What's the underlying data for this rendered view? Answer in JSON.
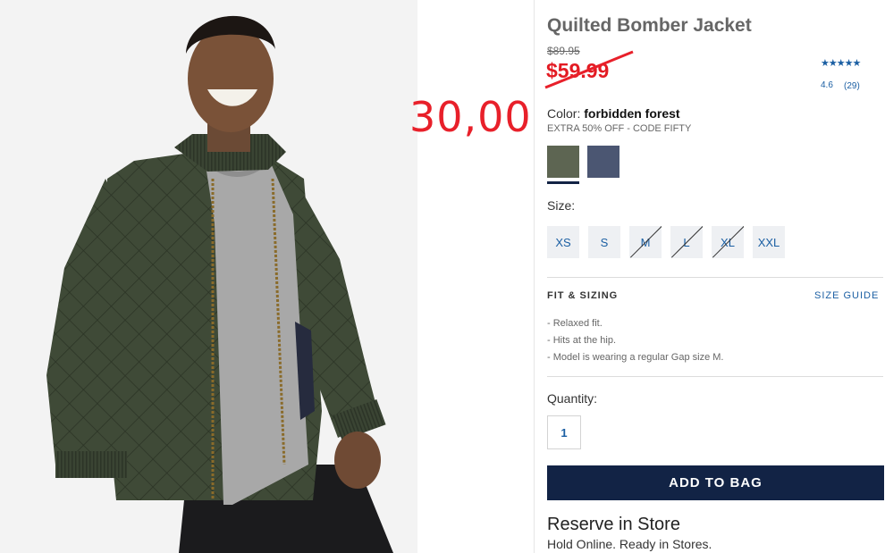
{
  "product": {
    "title": "Quilted Bomber Jacket",
    "original_price": "$89.95",
    "sale_price": "$59.99",
    "rating": {
      "stars": "★★★★★",
      "score": "4.6",
      "count": "(29)",
      "value": 4.6
    }
  },
  "annotation": {
    "text": "30,00",
    "color": "#e8202a"
  },
  "color": {
    "label": "Color:",
    "selected": "forbidden forest",
    "promo": "EXTRA 50% OFF - CODE FIFTY",
    "swatches": [
      {
        "name": "forbidden forest",
        "hex": "#5d6552",
        "selected": true
      },
      {
        "name": "navy",
        "hex": "#4b5672",
        "selected": false
      }
    ]
  },
  "size": {
    "label": "Size:",
    "options": [
      {
        "label": "XS",
        "available": true
      },
      {
        "label": "S",
        "available": true
      },
      {
        "label": "M",
        "available": false
      },
      {
        "label": "L",
        "available": false
      },
      {
        "label": "XL",
        "available": false
      },
      {
        "label": "XXL",
        "available": true
      }
    ]
  },
  "fit": {
    "title": "FIT & SIZING",
    "guide_link": "SIZE GUIDE",
    "items": [
      "Relaxed fit.",
      "Hits at the hip.",
      "Model is wearing a regular Gap size M."
    ]
  },
  "quantity": {
    "label": "Quantity:",
    "value": "1"
  },
  "cta": {
    "add_to_bag": "ADD TO BAG"
  },
  "reserve": {
    "title": "Reserve in Store",
    "subtitle": "Hold Online. Ready in Stores."
  },
  "colors": {
    "accent": "#1b5fa3",
    "sale": "#e31b23",
    "navy_button": "#122345"
  }
}
